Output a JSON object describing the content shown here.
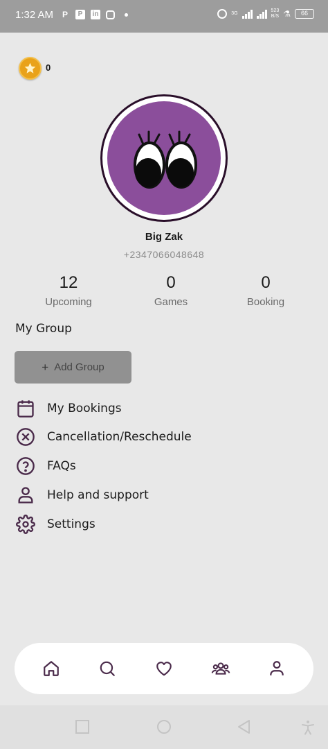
{
  "status_bar": {
    "time": "1:32 AM",
    "apps": [
      "P",
      "P",
      "in",
      "o"
    ],
    "network_type": "3G",
    "net_speed_value": "523",
    "net_speed_unit": "B/S",
    "battery": "66"
  },
  "coins": {
    "count": "0"
  },
  "profile": {
    "name": "Big Zak",
    "phone": "+2347066048648"
  },
  "stats": [
    {
      "value": "12",
      "label": "Upcoming"
    },
    {
      "value": "0",
      "label": "Games"
    },
    {
      "value": "0",
      "label": "Booking"
    }
  ],
  "group": {
    "title": "My Group",
    "add_label": "Add Group",
    "add_icon": "plus-icon"
  },
  "menu": [
    {
      "label": "My Bookings",
      "icon": "calendar-icon"
    },
    {
      "label": "Cancellation/Reschedule",
      "icon": "close-circle-icon"
    },
    {
      "label": "FAQs",
      "icon": "help-circle-icon"
    },
    {
      "label": "Help and support",
      "icon": "person-icon"
    },
    {
      "label": "Settings",
      "icon": "gear-icon"
    }
  ],
  "bottom_nav": [
    "home-icon",
    "search-icon",
    "heart-icon",
    "group-icon",
    "profile-icon"
  ],
  "colors": {
    "accent": "#4a2a4a",
    "avatar_bg": "#8b4e9b",
    "background": "#e8e8e8",
    "button_bg": "#919191",
    "coin": "#e9a21a"
  }
}
